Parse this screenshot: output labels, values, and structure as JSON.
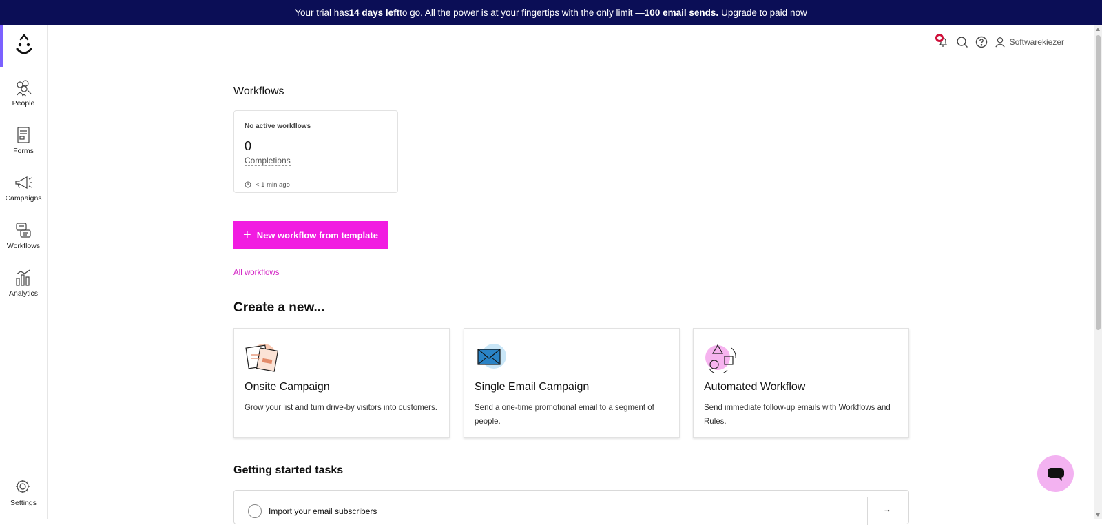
{
  "banner": {
    "part1": "Your trial has ",
    "days_left": "14 days left",
    "part2": " to go. All the power is at your fingertips with the only limit — ",
    "limit": "100 email sends.",
    "upgrade_link": "Upgrade to paid now",
    "bg_color": "#0b0e56"
  },
  "sidebar": {
    "items": [
      {
        "label": "People",
        "icon": "people-icon"
      },
      {
        "label": "Forms",
        "icon": "forms-icon"
      },
      {
        "label": "Campaigns",
        "icon": "megaphone-icon"
      },
      {
        "label": "Workflows",
        "icon": "workflows-icon"
      },
      {
        "label": "Analytics",
        "icon": "analytics-icon"
      }
    ],
    "settings_label": "Settings"
  },
  "topbar": {
    "username": "Softwarekiezer"
  },
  "workflows": {
    "heading": "Workflows",
    "card_title": "No active workflows",
    "completions_value": "0",
    "completions_label": "Completions",
    "updated": "< 1 min ago",
    "new_button": "New workflow from template",
    "all_link": "All workflows"
  },
  "create": {
    "heading": "Create a new...",
    "cards": [
      {
        "title": "Onsite Campaign",
        "desc": "Grow your list and turn drive-by visitors into customers."
      },
      {
        "title": "Single Email Campaign",
        "desc": "Send a one-time promotional email to a segment of people."
      },
      {
        "title": "Automated Workflow",
        "desc": "Send immediate follow-up emails with Workflows and Rules."
      }
    ]
  },
  "tasks": {
    "heading": "Getting started tasks",
    "items": [
      {
        "label": "Import your email subscribers"
      }
    ]
  },
  "colors": {
    "accent": "#f11ce1",
    "link": "#d323c4",
    "logo_accent": "#7b61ff"
  }
}
